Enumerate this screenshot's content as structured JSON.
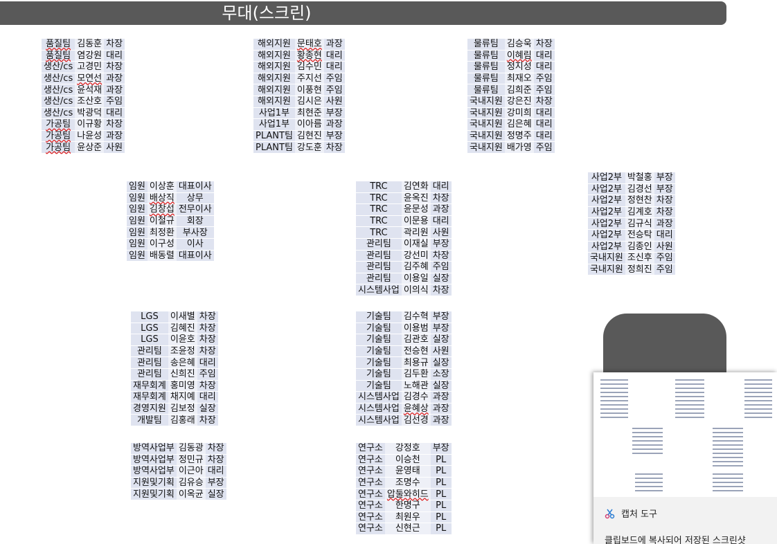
{
  "stage": {
    "title": "무대(스크린)"
  },
  "groups": [
    {
      "id": "g1",
      "rows": [
        [
          "품질팀",
          "김동훈",
          "차장"
        ],
        [
          "품질팀",
          "염강원",
          "대리"
        ],
        [
          "생산/cs",
          "고경민",
          "차장"
        ],
        [
          "생산/cs",
          "모연선",
          "과장"
        ],
        [
          "생산/cs",
          "윤석재",
          "과장"
        ],
        [
          "생산/cs",
          "조산호",
          "주임"
        ],
        [
          "생산/cs",
          "박광덕",
          "대리"
        ],
        [
          "가공팀",
          "이규황",
          "차장"
        ],
        [
          "가공팀",
          "나윤성",
          "과장"
        ],
        [
          "가공팀",
          "윤상준",
          "사원"
        ]
      ]
    },
    {
      "id": "g2",
      "rows": [
        [
          "해외지원",
          "문태호",
          "과장"
        ],
        [
          "해외지원",
          "황종현",
          "대리"
        ],
        [
          "해외지원",
          "김수민",
          "대리"
        ],
        [
          "해외지원",
          "주지선",
          "주임"
        ],
        [
          "해외지원",
          "이풍현",
          "주임"
        ],
        [
          "해외지원",
          "김시은",
          "사원"
        ],
        [
          "사업1부",
          "최현준",
          "부장"
        ],
        [
          "사업1부",
          "이아름",
          "과장"
        ],
        [
          "PLANT팀",
          "김현진",
          "부장"
        ],
        [
          "PLANT팀",
          "강도훈",
          "차장"
        ]
      ]
    },
    {
      "id": "g3",
      "rows": [
        [
          "물류팀",
          "김승욱",
          "차장"
        ],
        [
          "물류팀",
          "이혜림",
          "대리"
        ],
        [
          "물류팀",
          "정지성",
          "대리"
        ],
        [
          "물류팀",
          "최재오",
          "주임"
        ],
        [
          "물류팀",
          "김희준",
          "주임"
        ],
        [
          "국내지원",
          "강은진",
          "차장"
        ],
        [
          "국내지원",
          "강미희",
          "대리"
        ],
        [
          "국내지원",
          "김은혜",
          "대리"
        ],
        [
          "국내지원",
          "정명주",
          "대리"
        ],
        [
          "국내지원",
          "배가영",
          "주임"
        ]
      ]
    },
    {
      "id": "g4",
      "rows": [
        [
          "임원",
          "이상훈",
          "대표이사"
        ],
        [
          "임원",
          "배상직",
          "상무"
        ],
        [
          "임원",
          "김창섭",
          "전무이사"
        ],
        [
          "임원",
          "이철규",
          "회장"
        ],
        [
          "임원",
          "최정환",
          "부사장"
        ],
        [
          "임원",
          "이구성",
          "이사"
        ],
        [
          "임원",
          "배동렬",
          "대표이사"
        ]
      ]
    },
    {
      "id": "g5",
      "rows": [
        [
          "TRC",
          "김연화",
          "대리"
        ],
        [
          "TRC",
          "윤옥진",
          "차장"
        ],
        [
          "TRC",
          "윤문성",
          "과장"
        ],
        [
          "TRC",
          "이문용",
          "대리"
        ],
        [
          "TRC",
          "곽리원",
          "사원"
        ],
        [
          "관리팀",
          "이재실",
          "부장"
        ],
        [
          "관리팀",
          "강선미",
          "차장"
        ],
        [
          "관리팀",
          "김주혜",
          "주임"
        ],
        [
          "관리팀",
          "이용일",
          "실장"
        ],
        [
          "시스템사업",
          "이의식",
          "차장"
        ]
      ]
    },
    {
      "id": "g6",
      "rows": [
        [
          "사업2부",
          "박철홍",
          "부장"
        ],
        [
          "사업2부",
          "김경선",
          "부장"
        ],
        [
          "사업2부",
          "정현찬",
          "차장"
        ],
        [
          "사업2부",
          "김계호",
          "차장"
        ],
        [
          "사업2부",
          "김규식",
          "과장"
        ],
        [
          "사업2부",
          "전승탁",
          "대리"
        ],
        [
          "사업2부",
          "김종인",
          "사원"
        ],
        [
          "국내지원",
          "조신후",
          "주임"
        ],
        [
          "국내지원",
          "정희진",
          "주임"
        ]
      ]
    },
    {
      "id": "g7",
      "rows": [
        [
          "LGS",
          "이새별",
          "차장"
        ],
        [
          "LGS",
          "김혜진",
          "차장"
        ],
        [
          "LGS",
          "이윤호",
          "차장"
        ],
        [
          "관리팀",
          "조윤정",
          "차장"
        ],
        [
          "관리팀",
          "송은혜",
          "대리"
        ],
        [
          "관리팀",
          "신희진",
          "주임"
        ],
        [
          "재무회계",
          "홍미영",
          "차장"
        ],
        [
          "재무회계",
          "채지예",
          "대리"
        ],
        [
          "경영지원",
          "김보정",
          "실장"
        ],
        [
          "개발팀",
          "김홍래",
          "차장"
        ]
      ]
    },
    {
      "id": "g8",
      "rows": [
        [
          "기술팀",
          "김수혁",
          "부장"
        ],
        [
          "기술팀",
          "이용범",
          "부장"
        ],
        [
          "기술팀",
          "김관호",
          "실장"
        ],
        [
          "기술팀",
          "전승현",
          "사원"
        ],
        [
          "기술팀",
          "최용규",
          "실장"
        ],
        [
          "기술팀",
          "김두환",
          "소장"
        ],
        [
          "기술팀",
          "노해관",
          "실장"
        ],
        [
          "시스템사업",
          "김경수",
          "과장"
        ],
        [
          "시스템사업",
          "윤혜상",
          "과장"
        ],
        [
          "시스템사업",
          "김선경",
          "과장"
        ]
      ]
    },
    {
      "id": "g9",
      "rows": [
        [
          "방역사업부",
          "김동광",
          "차장"
        ],
        [
          "방역사업부",
          "정민규",
          "차장"
        ],
        [
          "방역사업부",
          "이근아",
          "대리"
        ],
        [
          "지원및기획",
          "김유승",
          "부장"
        ],
        [
          "지원및기획",
          "이옥균",
          "실장"
        ]
      ]
    },
    {
      "id": "g10",
      "rows": [
        [
          "연구소",
          "강정호",
          "부장"
        ],
        [
          "연구소",
          "이승천",
          "PL"
        ],
        [
          "연구소",
          "윤영태",
          "PL"
        ],
        [
          "연구소",
          "조명수",
          "PL"
        ],
        [
          "연구소",
          "압둘와히드",
          "PL"
        ],
        [
          "연구소",
          "한명구",
          "PL"
        ],
        [
          "연구소",
          "최원우",
          "PL"
        ],
        [
          "연구소",
          "신현근",
          "PL"
        ]
      ]
    }
  ],
  "misspelled": [
    "품질팀",
    "모연선",
    "가공팀",
    "문태호",
    "황종현",
    "이혜림",
    "배상직",
    "김창섭",
    "압둘와히드",
    "윤혜상"
  ],
  "notification": {
    "app_name": "캡처 도구",
    "message": "클립보드에 복사되어 저장된 스크린샷",
    "icon": "snipping-tool-icon"
  },
  "colors": {
    "stage": "#595959",
    "cell_dark": "#dfe3f0",
    "cell_light": "#eef0f7"
  }
}
